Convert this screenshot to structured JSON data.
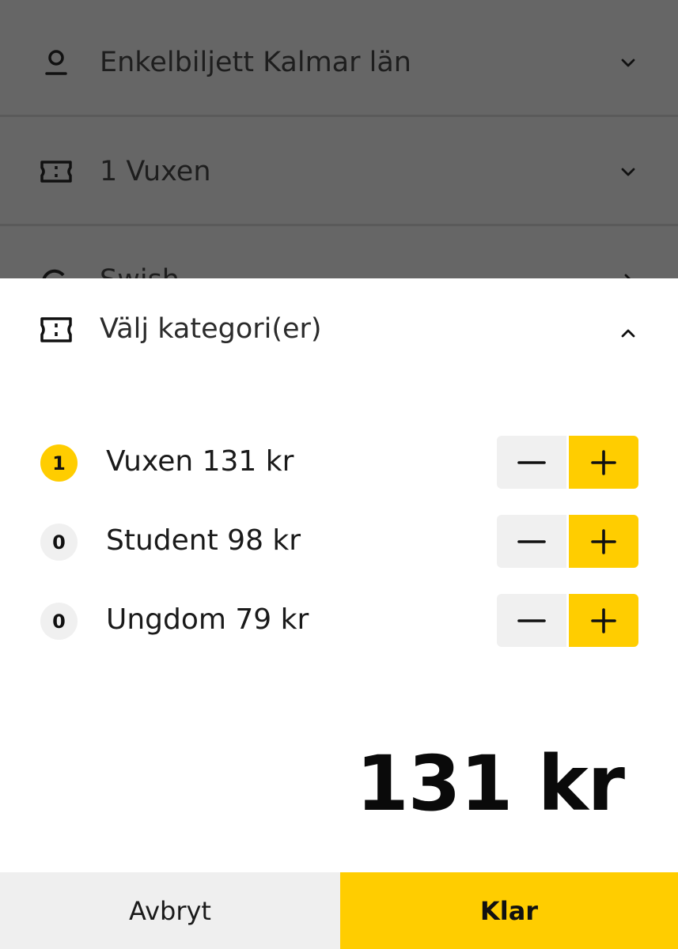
{
  "background_list": {
    "items": [
      {
        "icon": "location-pin-icon",
        "label": "Enkelbiljett Kalmar län"
      },
      {
        "icon": "ticket-icon",
        "label": "1 Vuxen"
      },
      {
        "icon": "swish-icon",
        "label": "Swish"
      }
    ]
  },
  "sheet": {
    "title": "Välj kategori(er)",
    "categories": [
      {
        "count": "1",
        "label": "Vuxen 131 kr"
      },
      {
        "count": "0",
        "label": "Student 98 kr"
      },
      {
        "count": "0",
        "label": "Ungdom 79 kr"
      }
    ],
    "total": "131 kr",
    "cancel_label": "Avbryt",
    "done_label": "Klar"
  },
  "colors": {
    "accent": "#ffcd00",
    "overlay": "#666666",
    "neutral_button": "#f0f0f0"
  }
}
